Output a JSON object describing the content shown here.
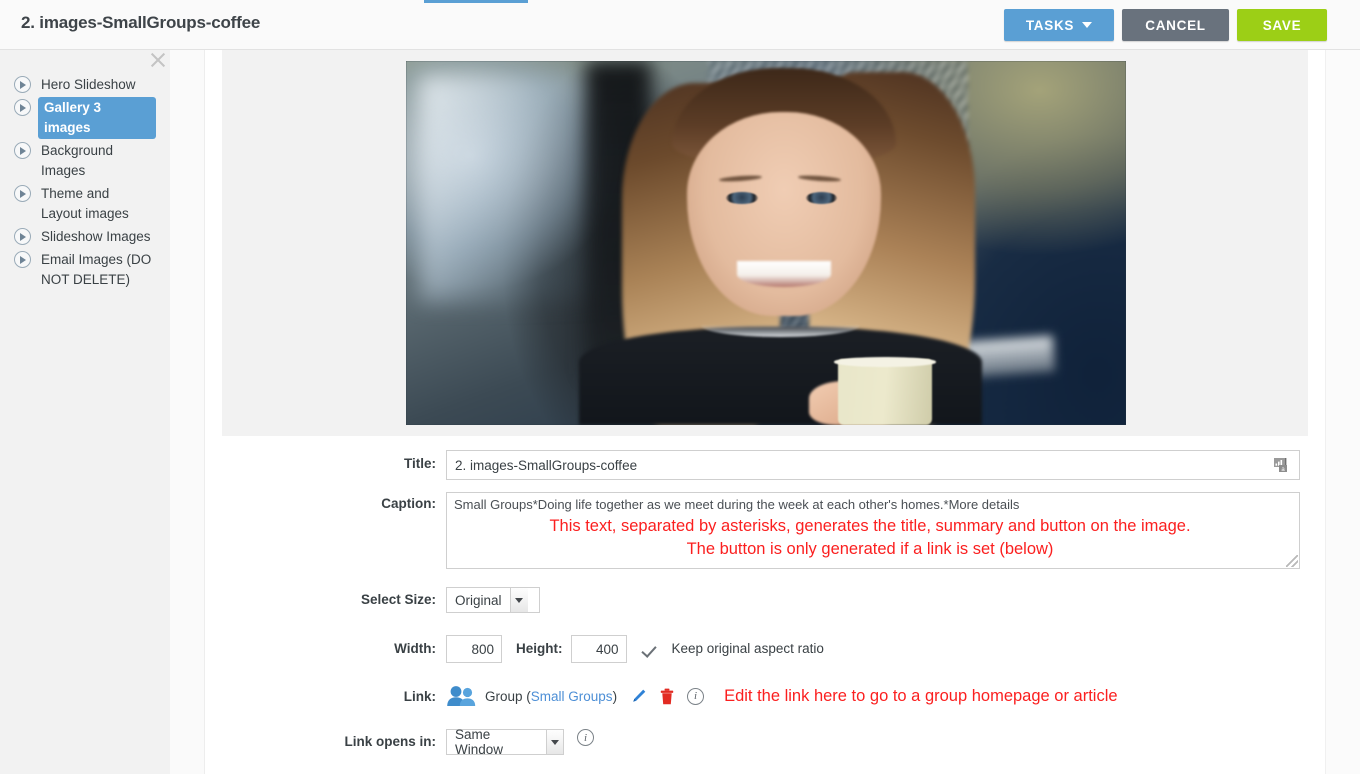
{
  "header": {
    "title": "2. images-SmallGroups-coffee",
    "tasks_label": "TASKS",
    "cancel_label": "CANCEL",
    "save_label": "SAVE",
    "accent_color": "#5a9fd4",
    "save_color": "#9ccf16",
    "cancel_color": "#69727d"
  },
  "sidebar": {
    "items": [
      {
        "label": "Hero Slideshow",
        "selected": false
      },
      {
        "label": "Gallery 3 images",
        "selected": true
      },
      {
        "label": "Background Images",
        "selected": false
      },
      {
        "label": "Theme and Layout images",
        "selected": false
      },
      {
        "label": "Slideshow Images",
        "selected": false
      },
      {
        "label": "Email Images (DO NOT DELETE)",
        "selected": false
      }
    ]
  },
  "form": {
    "title": {
      "label": "Title:",
      "value": "2. images-SmallGroups-coffee"
    },
    "caption": {
      "label": "Caption:",
      "value": "Small Groups*Doing life together as we meet during the week at each other's homes.*More details",
      "hint_line1": "This text, separated by asterisks, generates the title, summary and button on the image.",
      "hint_line2": "The button is only generated if a link is set (below)",
      "hint_color": "#fb1f1f"
    },
    "select_size": {
      "label": "Select Size:",
      "value": "Original"
    },
    "dimensions": {
      "width_label": "Width:",
      "width_value": "800",
      "height_label": "Height:",
      "height_value": "400",
      "aspect_label": "Keep original aspect ratio",
      "aspect_checked": true
    },
    "link": {
      "label": "Link:",
      "type_text": "Group (",
      "target_name": "Small Groups",
      "type_text_end": ")",
      "hint": "Edit the link here to go to a group homepage or article",
      "hint_color": "#fb1f1f"
    },
    "link_opens": {
      "label": "Link opens in:",
      "value": "Same Window"
    }
  }
}
